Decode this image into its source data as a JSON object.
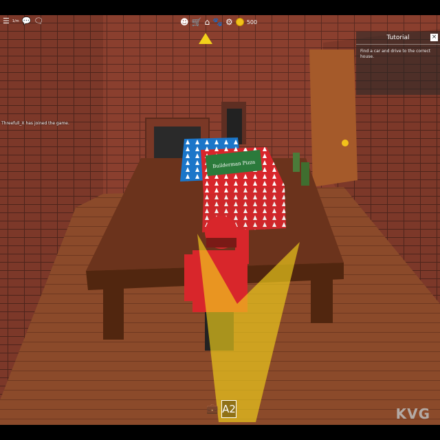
{
  "hud": {
    "left_icons": [
      "menu-icon",
      "chat-icon",
      "notification-icon"
    ],
    "left_small_text": "1/m",
    "center_icons": [
      "avatar-icon",
      "cart-icon",
      "home-icon",
      "pet-icon",
      "gear-icon"
    ],
    "money": "500"
  },
  "tutorial": {
    "title": "Tutorial",
    "close": "×",
    "text": "Find a car and drive to the correct house."
  },
  "chat": {
    "message": "Threefull_X has joined the game."
  },
  "toolbar": {
    "tool_icon": "briefcase-icon",
    "slot_label": "A2"
  },
  "scene": {
    "pizza_box_text": "Builderman Pizza"
  },
  "watermark": "KVG"
}
